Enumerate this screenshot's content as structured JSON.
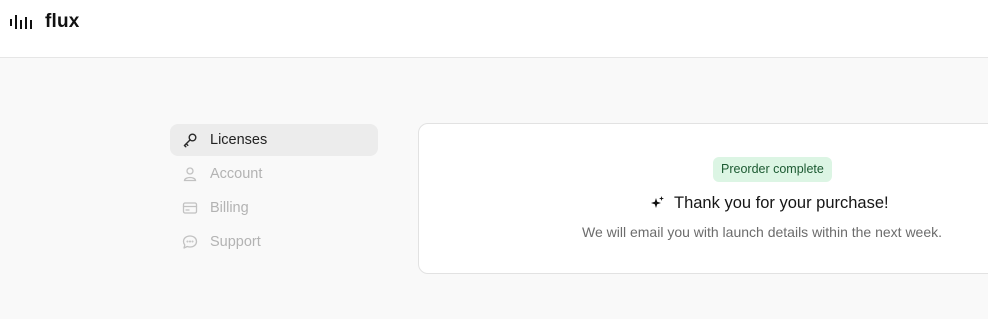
{
  "brand": {
    "name": "flux",
    "icon": "soundwave-logo-icon"
  },
  "sidebar": {
    "items": [
      {
        "label": "Licenses",
        "icon": "key-icon",
        "active": true
      },
      {
        "label": "Account",
        "icon": "user-icon",
        "active": false
      },
      {
        "label": "Billing",
        "icon": "credit-card-icon",
        "active": false
      },
      {
        "label": "Support",
        "icon": "chat-bubble-icon",
        "active": false
      }
    ]
  },
  "confirmation": {
    "badge": "Preorder complete",
    "headline": "Thank you for your purchase!",
    "headline_icon": "sparkles-icon",
    "message": "We will email you with launch details within the next week."
  },
  "colors": {
    "badge_bg": "#dcf5e4",
    "badge_text": "#1c5a32",
    "active_item_bg": "#ececec",
    "inactive_text": "#b3b3b3"
  }
}
